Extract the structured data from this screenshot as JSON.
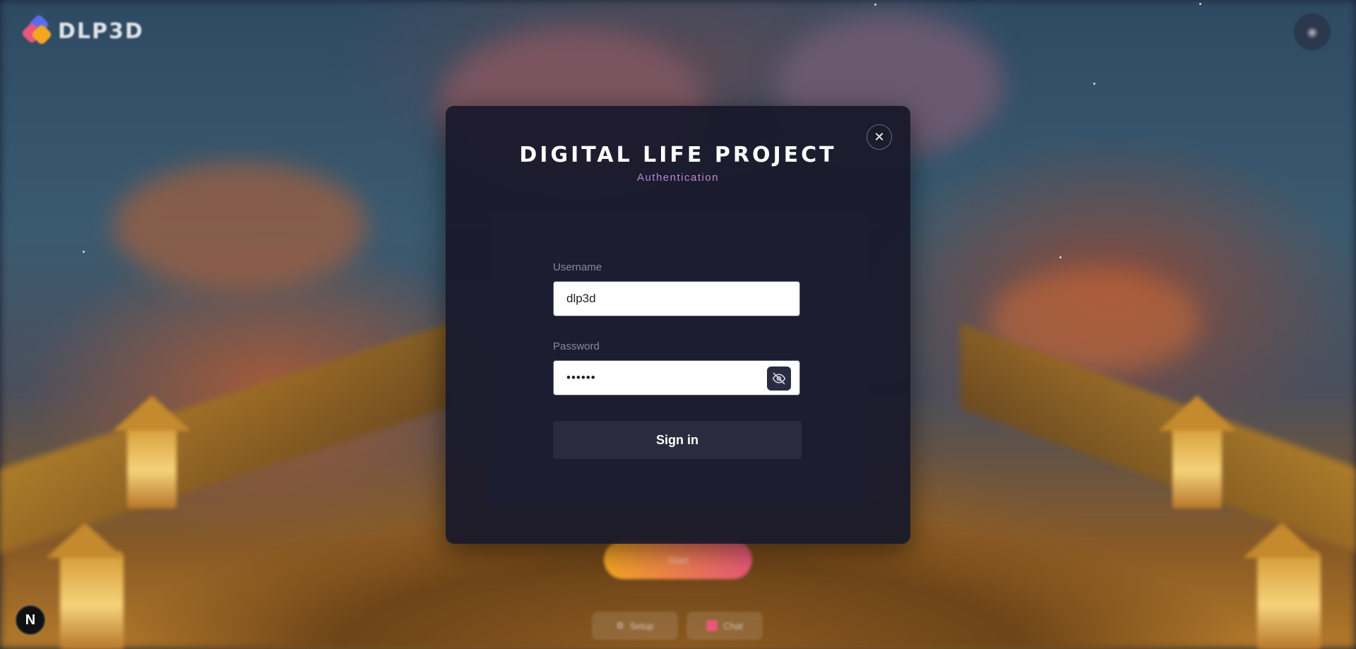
{
  "app": {
    "logo_text": "DLP3D"
  },
  "background": {
    "start_button_label": "Start",
    "bottom_pills": [
      {
        "label": "Setup"
      },
      {
        "label": "Chat"
      }
    ]
  },
  "modal": {
    "title": "DIGITAL LIFE PROJECT",
    "subtitle": "Authentication",
    "close_icon": "close-icon",
    "username": {
      "label": "Username",
      "value": "dlp3d"
    },
    "password": {
      "label": "Password",
      "value": "••••••",
      "toggle_icon": "eye-off-icon"
    },
    "submit_label": "Sign in"
  },
  "badge": {
    "letter": "N"
  },
  "colors": {
    "modal_bg": "#18182a",
    "card_bg": "#1d1d31",
    "button_bg": "#2b2b3d",
    "subtitle_gradient": [
      "#6f7cf0",
      "#f09a8a"
    ]
  }
}
